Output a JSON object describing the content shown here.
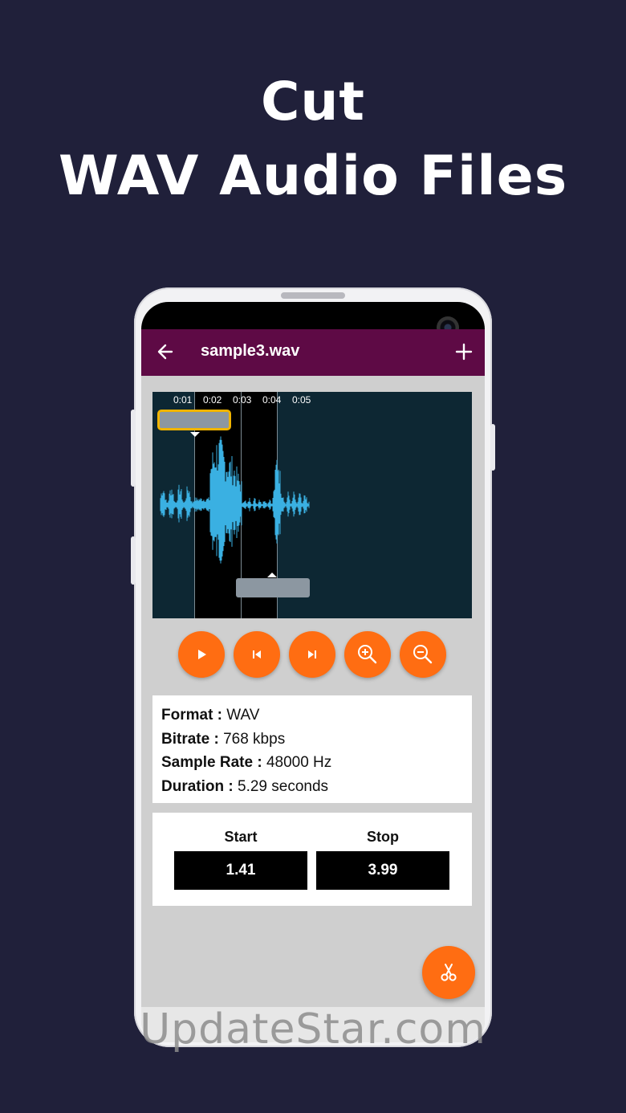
{
  "headline": {
    "line1": "Cut",
    "line2": "WAV Audio Files"
  },
  "app_bar": {
    "title": "sample3.wav",
    "back_icon": "arrow-left-icon",
    "add_icon": "plus-icon"
  },
  "waveform": {
    "time_ticks": [
      "0:01",
      "0:02",
      "0:03",
      "0:04",
      "0:05"
    ],
    "wave_color": "#3ab0e2",
    "background_color": "#0d2733",
    "selection_handle_color": "#f0b400"
  },
  "controls": [
    {
      "name": "play",
      "icon": "play-icon"
    },
    {
      "name": "previous",
      "icon": "skip-previous-icon"
    },
    {
      "name": "next",
      "icon": "skip-next-icon"
    },
    {
      "name": "zoom-in",
      "icon": "zoom-in-icon"
    },
    {
      "name": "zoom-out",
      "icon": "zoom-out-icon"
    }
  ],
  "info": {
    "format_label": "Format :",
    "format_value": "WAV",
    "bitrate_label": "Bitrate :",
    "bitrate_value": "768 kbps",
    "sample_rate_label": "Sample Rate :",
    "sample_rate_value": "48000 Hz",
    "duration_label": "Duration :",
    "duration_value": "5.29 seconds"
  },
  "range": {
    "start_label": "Start",
    "start_value": "1.41",
    "stop_label": "Stop",
    "stop_value": "3.99"
  },
  "fab": {
    "icon": "scissors-icon"
  },
  "watermark": "UpdateStar.com",
  "colors": {
    "background": "#20203a",
    "app_bar": "#5e0a45",
    "accent": "#ff6d12"
  }
}
